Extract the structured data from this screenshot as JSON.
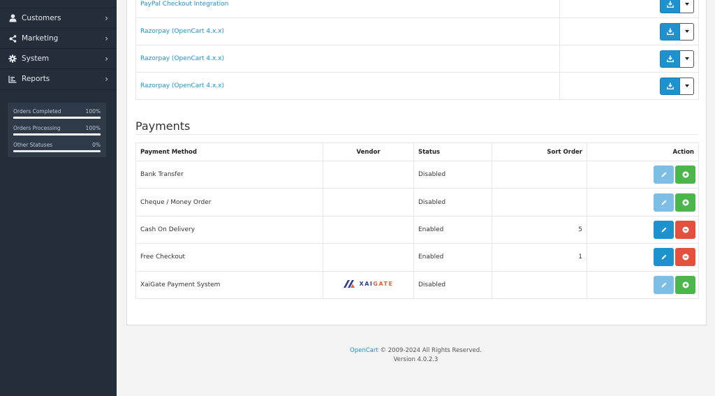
{
  "sidebar": {
    "items": [
      {
        "label": "",
        "icon": "partial-icon"
      },
      {
        "label": "Customers",
        "icon": "user-icon"
      },
      {
        "label": "Marketing",
        "icon": "share-icon"
      },
      {
        "label": "System",
        "icon": "gear-icon"
      },
      {
        "label": "Reports",
        "icon": "chart-bar-icon"
      }
    ],
    "stats": [
      {
        "label": "Orders Completed",
        "value": "100%",
        "percent": 100
      },
      {
        "label": "Orders Processing",
        "value": "100%",
        "percent": 100
      },
      {
        "label": "Other Statuses",
        "value": "0%",
        "percent": 0
      }
    ]
  },
  "extensions": {
    "rows": [
      {
        "name": "PayPal Checkout Integration"
      },
      {
        "name": "Razorpay (OpenCart 4.x.x)"
      },
      {
        "name": "Razorpay (OpenCart 4.x.x)"
      },
      {
        "name": "Razorpay (OpenCart 4.x.x)"
      }
    ]
  },
  "payments": {
    "title": "Payments",
    "columns": [
      "Payment Method",
      "Vendor",
      "Status",
      "Sort Order",
      "Action"
    ],
    "rows": [
      {
        "method": "Bank Transfer",
        "vendor": "",
        "status": "Disabled",
        "sort_order": "",
        "installed": false
      },
      {
        "method": "Cheque / Money Order",
        "vendor": "",
        "status": "Disabled",
        "sort_order": "",
        "installed": false
      },
      {
        "method": "Cash On Delivery",
        "vendor": "",
        "status": "Enabled",
        "sort_order": "5",
        "installed": true
      },
      {
        "method": "Free Checkout",
        "vendor": "",
        "status": "Enabled",
        "sort_order": "1",
        "installed": true
      },
      {
        "method": "XaiGate Payment System",
        "vendor": "XAIGATE",
        "vendor_logo_part1": "XAI",
        "vendor_logo_part2": "GATE",
        "status": "Disabled",
        "sort_order": "",
        "installed": false
      }
    ]
  },
  "footer": {
    "brand_link": "OpenCart",
    "copyright": " © 2009-2024 All Rights Reserved.",
    "version": "Version 4.0.2.3"
  },
  "colors": {
    "sidebar_bg": "#242d3a",
    "primary": "#1e91cf",
    "success": "#4cb64c",
    "danger": "#e3503e",
    "vendor_blue": "#2c3e8c",
    "vendor_orange": "#e8603c"
  }
}
